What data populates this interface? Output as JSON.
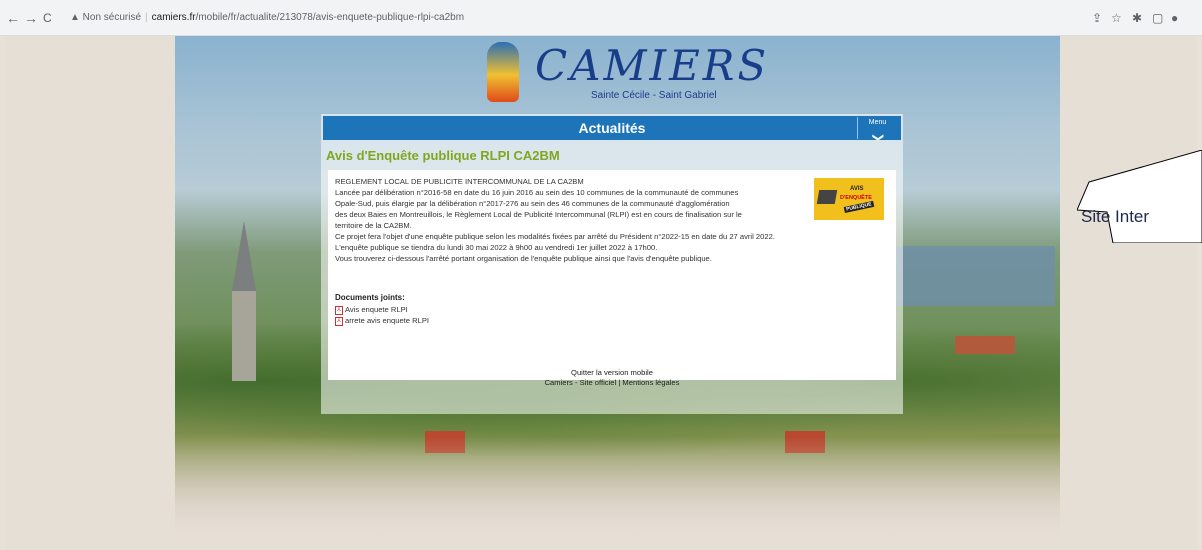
{
  "browser": {
    "back": "←",
    "forward": "→",
    "reload": "C",
    "security_warning": "▲ Non sécurisé",
    "url_host": "camiers.fr",
    "url_path": "/mobile/fr/actualite/213078/avis-enquete-publique-rlpi-ca2bm",
    "toolbar_icons": [
      "share-icon",
      "star-icon",
      "extensions-icon",
      "sidepanel-icon",
      "profile-icon"
    ]
  },
  "logo": {
    "wordmark": "CAMIERS",
    "subtitle": "Sainte Cécile - Saint Gabriel"
  },
  "header": {
    "title": "Actualités",
    "menu_label": "Menu",
    "menu_chevron": "❯"
  },
  "article": {
    "title": "Avis d'Enquête publique RLPI CA2BM",
    "lines": [
      "REGLEMENT LOCAL DE PUBLICITE INTERCOMMUNAL DE LA CA2BM",
      "Lancée par délibération n°2016-58 en date du 16 juin 2016 au sein des 10 communes de la communauté de communes",
      "Opale-Sud, puis élargie par la délibération n°2017-276 au sein des 46 communes de la communauté d'agglomération",
      "des deux Baies en Montreuillois, le Règlement Local de Publicité Intercommunal (RLPI) est en cours de finalisation sur le",
      "territoire de la CA2BM.",
      "Ce projet fera l'objet d'une enquête publique selon les modalités fixées par arrêté du Président n°2022-15 en date du 27 avril 2022.",
      "L'enquête publique se tiendra du lundi 30 mai 2022 à 9h00 au vendredi 1er juillet 2022 à 17h00.",
      "Vous trouverez ci-dessous l'arrêté portant organisation de l'enquête publique ainsi que l'avis d'enquête publique."
    ],
    "badge": {
      "line1": "AVIS",
      "line2": "D'ENQUÊTE",
      "line3": "PUBLIQUE"
    },
    "docs_heading": "Documents joints:",
    "docs": [
      "Avis enquete RLPI",
      "arrete avis enquete RLPI"
    ]
  },
  "footer": {
    "mobile_quit": "Quitter la version mobile",
    "official_site": "Camiers - Site officiel",
    "separator": "|",
    "legal": "Mentions légales"
  },
  "callout": {
    "label": "Site Inter"
  }
}
